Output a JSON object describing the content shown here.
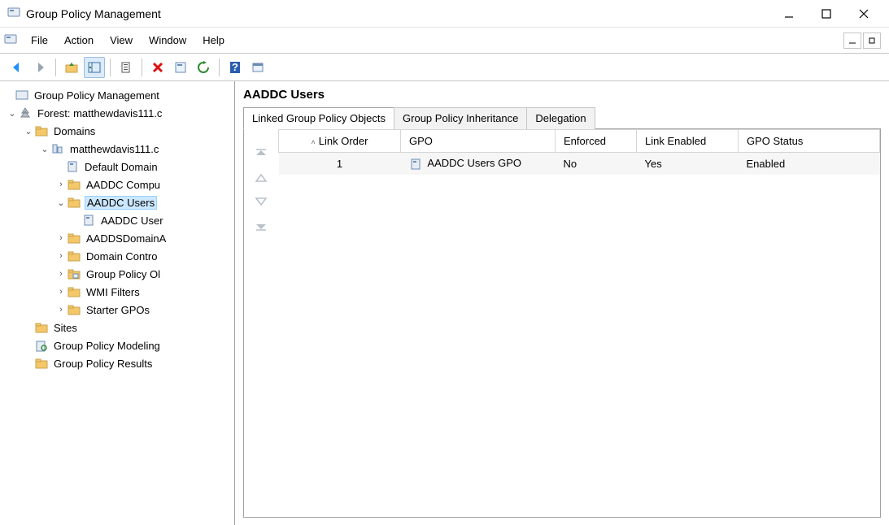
{
  "window": {
    "title": "Group Policy Management"
  },
  "menu": {
    "file": "File",
    "action": "Action",
    "view": "View",
    "window": "Window",
    "help": "Help"
  },
  "tree": {
    "root": "Group Policy Management",
    "forest": "Forest: matthewdavis111.c",
    "domains": "Domains",
    "domain": "matthewdavis111.c",
    "default_domain": "Default Domain",
    "aaddc_compu": "AADDC Compu",
    "aaddc_users": "AADDC Users",
    "aaddc_users_gpo_node": "AADDC User",
    "aadds_domain": "AADDSDomainA",
    "domain_contro": "Domain Contro",
    "gpo": "Group Policy Ol",
    "wmi_filters": "WMI Filters",
    "starter_gpos": "Starter GPOs",
    "sites": "Sites",
    "gp_modeling": "Group Policy Modeling",
    "gp_results": "Group Policy Results"
  },
  "detail": {
    "title": "AADDC Users",
    "tabs": {
      "linked": "Linked Group Policy Objects",
      "inheritance": "Group Policy Inheritance",
      "delegation": "Delegation"
    },
    "columns": {
      "link_order": "Link Order",
      "gpo": "GPO",
      "enforced": "Enforced",
      "link_enabled": "Link Enabled",
      "gpo_status": "GPO Status"
    },
    "rows": [
      {
        "order": "1",
        "gpo": "AADDC Users GPO",
        "enforced": "No",
        "link_enabled": "Yes",
        "gpo_status": "Enabled"
      }
    ]
  }
}
